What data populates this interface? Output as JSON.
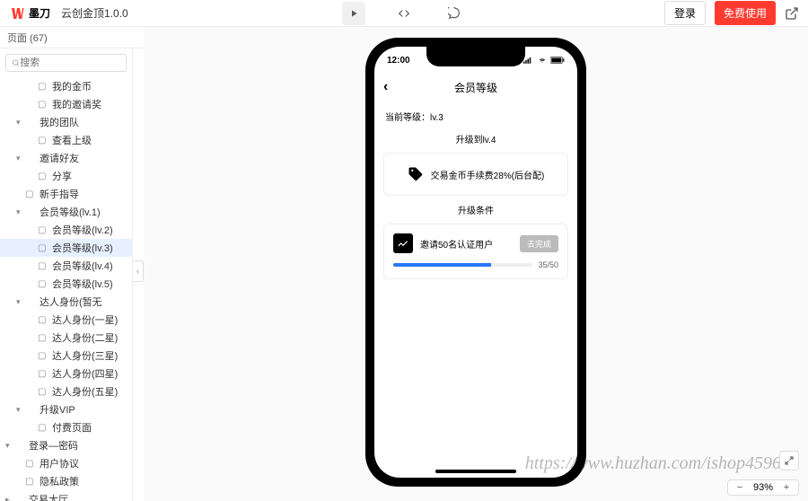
{
  "header": {
    "logo_text": "墨刀",
    "project_title": "云创金顶1.0.0",
    "login": "登录",
    "free_use": "免费使用"
  },
  "subbar": {
    "pages_label": "页面  (67)"
  },
  "search": {
    "placeholder": "搜索"
  },
  "tree": [
    {
      "label": "我的金币",
      "indent": 2,
      "type": "page"
    },
    {
      "label": "我的邀请奖",
      "indent": 2,
      "type": "page"
    },
    {
      "label": "我的团队",
      "indent": 1,
      "type": "folder",
      "expanded": true
    },
    {
      "label": "查看上级",
      "indent": 2,
      "type": "page"
    },
    {
      "label": "邀请好友",
      "indent": 1,
      "type": "folder",
      "expanded": true
    },
    {
      "label": "分享",
      "indent": 2,
      "type": "page"
    },
    {
      "label": "新手指导",
      "indent": 1,
      "type": "page"
    },
    {
      "label": "会员等级(lv.1)",
      "indent": 1,
      "type": "folder",
      "expanded": true
    },
    {
      "label": "会员等级(lv.2)",
      "indent": 2,
      "type": "page"
    },
    {
      "label": "会员等级(lv.3)",
      "indent": 2,
      "type": "page",
      "selected": true
    },
    {
      "label": "会员等级(lv.4)",
      "indent": 2,
      "type": "page"
    },
    {
      "label": "会员等级(lv.5)",
      "indent": 2,
      "type": "page"
    },
    {
      "label": "达人身份(暂无",
      "indent": 1,
      "type": "folder",
      "expanded": true
    },
    {
      "label": "达人身份(一星)",
      "indent": 2,
      "type": "page"
    },
    {
      "label": "达人身份(二星)",
      "indent": 2,
      "type": "page"
    },
    {
      "label": "达人身份(三星)",
      "indent": 2,
      "type": "page"
    },
    {
      "label": "达人身份(四星)",
      "indent": 2,
      "type": "page"
    },
    {
      "label": "达人身份(五星)",
      "indent": 2,
      "type": "page"
    },
    {
      "label": "升级VIP",
      "indent": 1,
      "type": "folder",
      "expanded": true
    },
    {
      "label": "付费页面",
      "indent": 2,
      "type": "page"
    },
    {
      "label": "登录—密码",
      "indent": 0,
      "type": "folder",
      "expanded": true
    },
    {
      "label": "用户协议",
      "indent": 1,
      "type": "page"
    },
    {
      "label": "隐私政策",
      "indent": 1,
      "type": "page"
    },
    {
      "label": "交易大厅",
      "indent": 0,
      "type": "folder",
      "expanded": false
    }
  ],
  "phone": {
    "time": "12:00",
    "nav_title": "会员等级",
    "current_level": "当前等级：lv.3",
    "upgrade_to": "升级到lv.4",
    "benefit": "交易金币手续费28%(后台配)",
    "conditions_title": "升级条件",
    "task_text": "邀请50名认证用户",
    "task_btn": "去完成",
    "progress_text": "35/50",
    "progress_percent": 70
  },
  "zoom": {
    "value": "93%"
  },
  "watermark": "https://www.huzhan.com/ishop45969"
}
